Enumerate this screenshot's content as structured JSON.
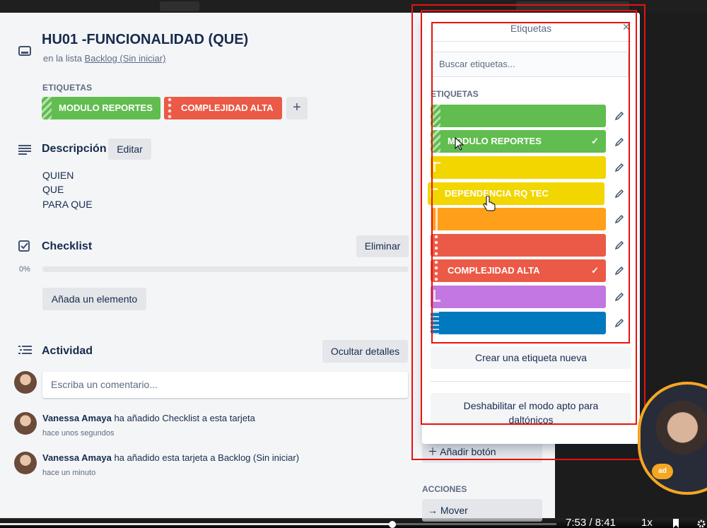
{
  "app": {
    "card_title": "HU01 -FUNCIONALIDAD (QUE)",
    "in_list_prefix": "en la lista",
    "list_name": "Backlog (Sin iniciar)"
  },
  "labels_section": {
    "heading": "ETIQUETAS",
    "chips": [
      {
        "text": "MODULO REPORTES",
        "color": "#61bd4f"
      },
      {
        "text": "COMPLEJIDAD ALTA",
        "color": "#eb5a46"
      }
    ],
    "add_symbol": "+"
  },
  "description": {
    "title": "Descripción",
    "edit_label": "Editar",
    "lines": [
      "QUIEN",
      "QUE",
      "PARA QUE"
    ]
  },
  "checklist": {
    "title": "Checklist",
    "delete_label": "Eliminar",
    "progress_text": "0%",
    "progress": 0,
    "add_item_label": "Añada un elemento"
  },
  "activity": {
    "title": "Actividad",
    "hide_details_label": "Ocultar detalles",
    "comment_placeholder": "Escriba un comentario...",
    "entries": [
      {
        "user": "Vanessa Amaya",
        "text": "ha añadido Checklist a esta tarjeta",
        "time": "hace unos segundos"
      },
      {
        "user": "Vanessa Amaya",
        "text": "ha añadido esta tarjeta a Backlog (Sin iniciar)",
        "time": "hace un minuto"
      }
    ]
  },
  "sidebar": {
    "add_button_label": "Añadir botón",
    "actions_heading": "ACCIONES",
    "move_label": "Mover"
  },
  "popover": {
    "title": "Etiquetas",
    "close_symbol": "×",
    "search_placeholder": "Buscar etiquetas...",
    "section_heading": "ETIQUETAS",
    "labels": [
      {
        "name": "",
        "color": "#61bd4f",
        "selected": false
      },
      {
        "name": "MODULO REPORTES",
        "color": "#61bd4f",
        "selected": true
      },
      {
        "name": "",
        "color": "#f2d600",
        "selected": false
      },
      {
        "name": "DEPENDENCIA RQ TEC",
        "color": "#f2d600",
        "selected": false
      },
      {
        "name": "",
        "color": "#ff9f1a",
        "selected": false
      },
      {
        "name": "",
        "color": "#eb5a46",
        "selected": false
      },
      {
        "name": "COMPLEJIDAD ALTA",
        "color": "#eb5a46",
        "selected": true
      },
      {
        "name": "",
        "color": "#c377e0",
        "selected": false
      },
      {
        "name": "",
        "color": "#0079bf",
        "selected": false
      }
    ],
    "check_symbol": "✓",
    "create_label": "Crear una etiqueta nueva",
    "colorblind_label_1": "Deshabilitar el modo apto para",
    "colorblind_label_2": "daltónicos"
  },
  "video": {
    "current_time": "7:53",
    "separator": "/",
    "duration": "8:41",
    "speed": "1x",
    "progress": 0.705
  },
  "webcam": {
    "badge_text": "ad"
  }
}
